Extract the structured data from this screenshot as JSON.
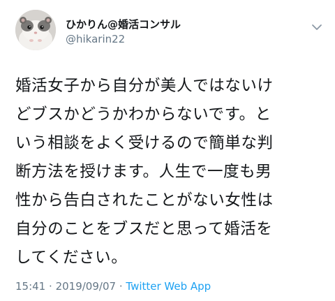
{
  "user": {
    "display_name": "ひかりん@婚活コンサル",
    "handle": "@hikarin22"
  },
  "icons": {
    "avatar": "hamster-avatar",
    "menu": "chevron-down-icon"
  },
  "tweet": {
    "lines": [
      "婚活女子から自分が美人ではないけ",
      "どブスかどうかわからないです。と",
      "いう相談をよく受けるので簡単な判",
      "断方法を授けます。人生で一度も男",
      "性から告白されたことがない女性は",
      "自分のことをブスだと思って婚活を",
      "してください。"
    ]
  },
  "meta": {
    "time": "15:41",
    "separator": "·",
    "date": "2019/09/07",
    "app": "Twitter Web App"
  },
  "colors": {
    "text": "#14171a",
    "secondary": "#657786",
    "link": "#1da1f2"
  }
}
